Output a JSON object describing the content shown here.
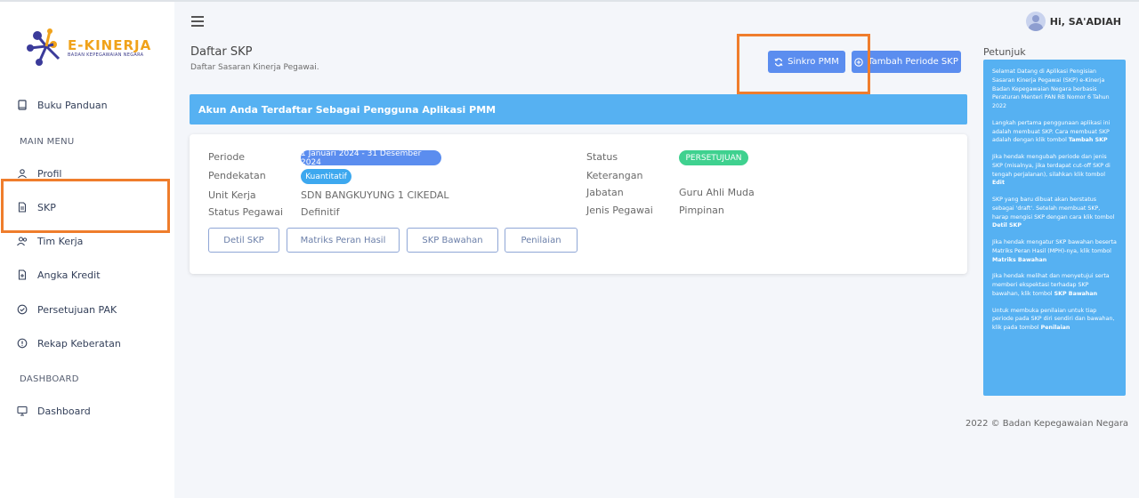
{
  "app": {
    "logo_text": "E-KINERJA",
    "logo_sub": "BADAN KEPEGAWAIAN NEGARA"
  },
  "sidebar": {
    "items_top": [
      {
        "label": "Buku Panduan",
        "icon": "book-icon"
      }
    ],
    "section_main": "MAIN MENU",
    "items_main": [
      {
        "label": "Profil",
        "icon": "user-icon"
      },
      {
        "label": "SKP",
        "icon": "document-icon"
      },
      {
        "label": "Tim Kerja",
        "icon": "users-icon"
      },
      {
        "label": "Angka Kredit",
        "icon": "file-plus-icon"
      },
      {
        "label": "Persetujuan PAK",
        "icon": "check-circle-icon"
      },
      {
        "label": "Rekap Keberatan",
        "icon": "info-circle-icon"
      }
    ],
    "section_dashboard": "DASHBOARD",
    "items_dashboard": [
      {
        "label": "Dashboard",
        "icon": "monitor-icon"
      }
    ]
  },
  "header": {
    "user_greeting": "Hi, SA'ADIAH"
  },
  "page": {
    "title": "Daftar SKP",
    "subtitle": "Daftar Sasaran Kinerja Pegawai.",
    "btn_sinkro": "Sinkro PMM",
    "btn_tambah": "Tambah Periode SKP",
    "alert": "Akun Anda Terdaftar Sebagai Pengguna Aplikasi PMM"
  },
  "card": {
    "periode_label": "Periode",
    "periode_value": "1 Januari 2024 - 31 Desember 2024",
    "pendekatan_label": "Pendekatan",
    "pendekatan_value": "Kuantitatif",
    "unit_label": "Unit Kerja",
    "unit_value": "SDN BANGKUYUNG 1 CIKEDAL",
    "status_pegawai_label": "Status Pegawai",
    "status_pegawai_value": "Definitif",
    "status_label": "Status",
    "status_value": "PERSETUJUAN",
    "keterangan_label": "Keterangan",
    "jabatan_label": "Jabatan",
    "jabatan_value": "Guru Ahli Muda",
    "jenis_label": "Jenis Pegawai",
    "jenis_value": "Pimpinan",
    "btn_detil": "Detil SKP",
    "btn_matriks": "Matriks Peran Hasil",
    "btn_bawahan": "SKP Bawahan",
    "btn_penilaian": "Penilaian"
  },
  "petunjuk": {
    "title": "Petunjuk",
    "p1": "Selamat Datang di Aplikasi Pengisian Sasaran Kinerja Pegawai (SKP) e-Kinerja Badan Kepegawaian Negara berbasis Peraturan Menteri PAN RB Nomor 6 Tahun 2022",
    "p2a": "Langkah pertama penggunaan aplikasi ini adalah membuat SKP. Cara membuat SKP adalah dengan klik tombol ",
    "p2b": "Tambah SKP",
    "p3a": "Jika hendak mengubah periode dan jenis SKP (misalnya, jika terdapat cut-off SKP di tengah perjalanan), silahkan klik tombol ",
    "p3b": "Edit",
    "p4a": "SKP yang baru dibuat akan berstatus sebagai 'draft'. Setelah membuat SKP, harap mengisi SKP dengan cara klik tombol ",
    "p4b": "Detil SKP",
    "p5a": "Jika hendak mengatur SKP bawahan beserta Matriks Peran Hasil (MPH)-nya, klik tombol ",
    "p5b": "Matriks Bawahan",
    "p6a": "Jika hendak melihat dan menyetujui serta memberi ekspektasi terhadap SKP bawahan, klik tombol ",
    "p6b": "SKP Bawahan",
    "p7a": "Untuk membuka penilaian untuk tiap periode pada SKP diri sendiri dan bawahan, klik pada tombol ",
    "p7b": "Penilaian"
  },
  "footer": "2022 © Badan Kepegawaian Negara",
  "colors": {
    "primary": "#5b8def",
    "info": "#56b1f2",
    "success": "#3fd18f",
    "highlight": "#ef7d2c"
  }
}
